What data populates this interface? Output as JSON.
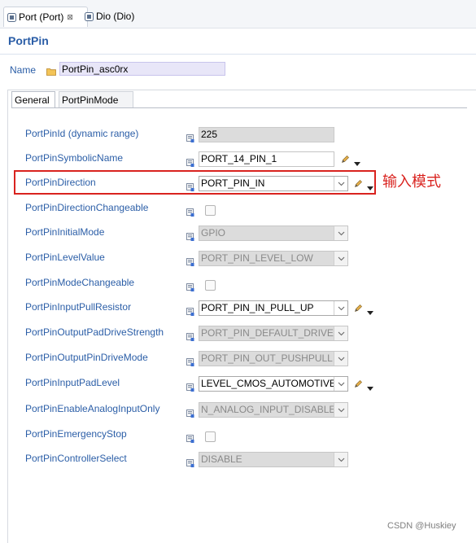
{
  "editor_tabs": [
    {
      "label": "Port (Port)",
      "close": "⊠",
      "active": true
    },
    {
      "label": "Dio (Dio)",
      "active": false
    }
  ],
  "page_title": "PortPin",
  "name": {
    "label": "Name",
    "value": "PortPin_asc0rx"
  },
  "sub_tabs": [
    {
      "label": "General",
      "active": true
    },
    {
      "label": "PortPinMode",
      "active": false
    }
  ],
  "params": [
    {
      "label": "PortPinId (dynamic range)",
      "value": "225",
      "kind": "readonly"
    },
    {
      "label": "PortPinSymbolicName",
      "value": "PORT_14_PIN_1",
      "kind": "text"
    },
    {
      "label": "PortPinDirection",
      "value": "PORT_PIN_IN",
      "kind": "combo"
    },
    {
      "label": "PortPinDirectionChangeable",
      "value": "",
      "kind": "checkbox"
    },
    {
      "label": "PortPinInitialMode",
      "value": "GPIO",
      "kind": "combo-disabled"
    },
    {
      "label": "PortPinLevelValue",
      "value": "PORT_PIN_LEVEL_LOW",
      "kind": "combo-disabled"
    },
    {
      "label": "PortPinModeChangeable",
      "value": "",
      "kind": "checkbox"
    },
    {
      "label": "PortPinInputPullResistor",
      "value": "PORT_PIN_IN_PULL_UP",
      "kind": "combo"
    },
    {
      "label": "PortPinOutputPadDriveStrength",
      "value": "PORT_PIN_DEFAULT_DRIVER",
      "kind": "combo-disabled"
    },
    {
      "label": "PortPinOutputPinDriveMode",
      "value": "PORT_PIN_OUT_PUSHPULL",
      "kind": "combo-disabled"
    },
    {
      "label": "PortPinInputPadLevel",
      "value": "LEVEL_CMOS_AUTOMOTIVE",
      "kind": "combo"
    },
    {
      "label": "PortPinEnableAnalogInputOnly",
      "value": "N_ANALOG_INPUT_DISABLE",
      "kind": "combo-disabled"
    },
    {
      "label": "PortPinEmergencyStop",
      "value": "",
      "kind": "checkbox"
    },
    {
      "label": "PortPinControllerSelect",
      "value": "DISABLE",
      "kind": "combo-disabled"
    }
  ],
  "annotation": "输入模式",
  "watermark": "CSDN @Huskiey",
  "colors": {
    "label_blue": "#2b5ea7",
    "highlight_red": "#d9231f",
    "readonly_gray": "#dcdcdc"
  },
  "icons": {
    "editor_tab": "config-editor-icon",
    "name": "folder-icon",
    "param": "parameter-default-icon",
    "edit": "pencil-icon",
    "menu": "dropdown-arrow-icon"
  }
}
